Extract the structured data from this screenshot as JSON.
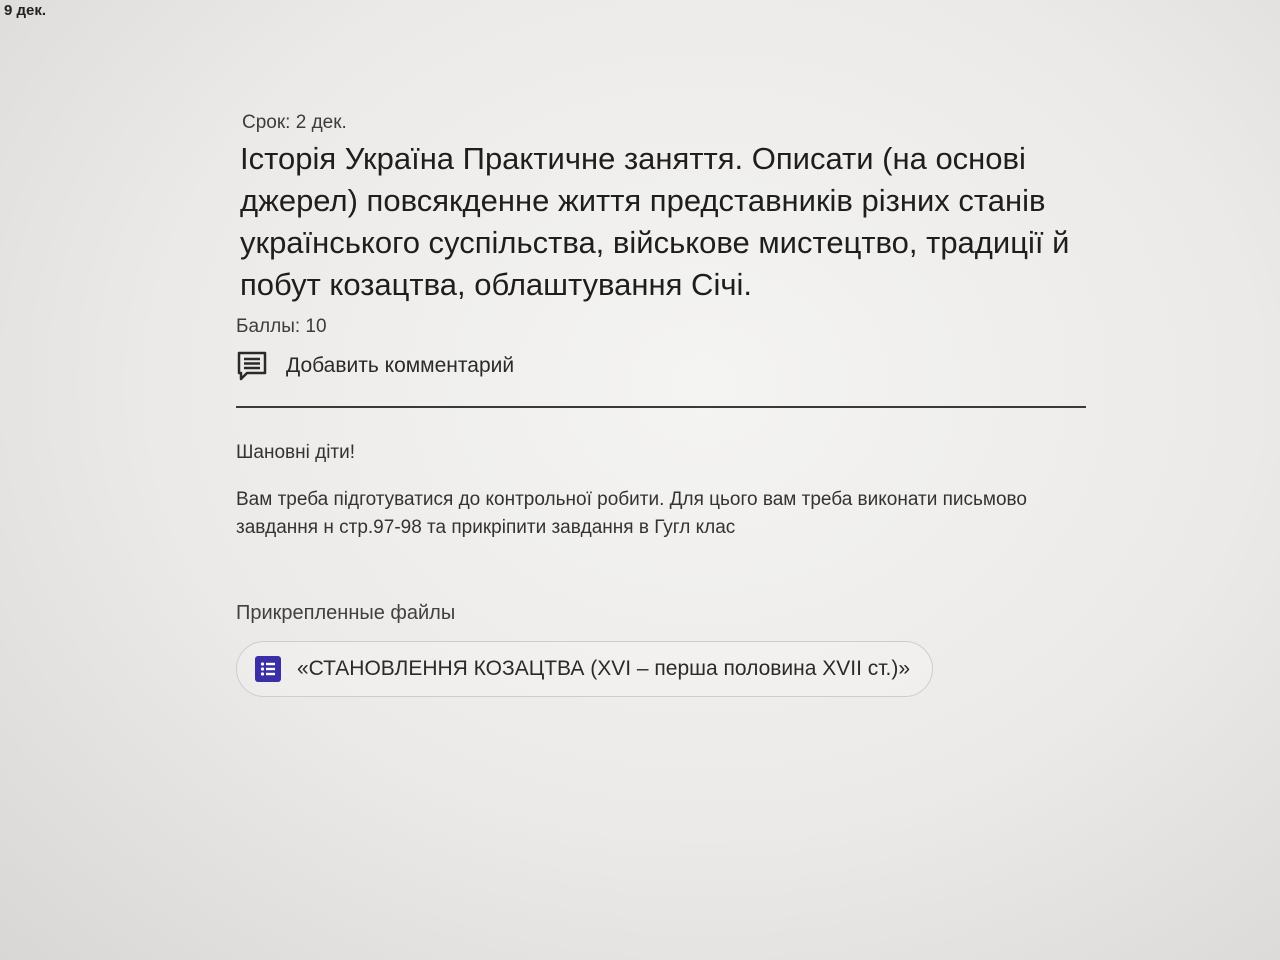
{
  "corner": {
    "date": "9 дек."
  },
  "assignment": {
    "due": "Срок: 2 дек.",
    "title": "Історія Україна Практичне заняття. Описати (на основі джерел) повсякденне життя представників різних станів українського суспільства, військове мистецтво, традиції й побут козацтва, облаштування Січі.",
    "points": "Баллы: 10",
    "add_comment_label": "Добавить комментарий",
    "greeting": "Шановні діти!",
    "instructions": "Вам треба підготуватися до контрольної робити. Для цього вам треба виконати письмово завдання н стр.97-98 та прикріпити завдання в Гугл клас",
    "attachments_heading": "Прикрепленные файлы",
    "attachment": {
      "label": "«СТАНОВЛЕННЯ КОЗАЦТВА (XVI – перша половина XVII ст.)»",
      "icon": "forms-icon",
      "icon_color": "#3b2fa8"
    }
  }
}
